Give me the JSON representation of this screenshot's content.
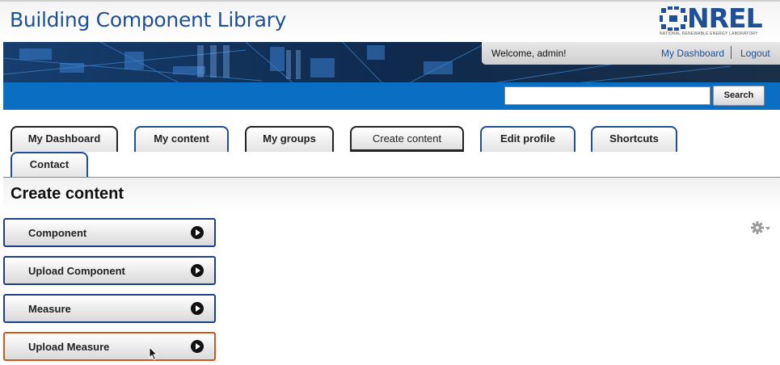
{
  "header": {
    "site_title": "Building Component Library",
    "logo_text": "NREL",
    "logo_subtitle": "NATIONAL RENEWABLE ENERGY LABORATORY"
  },
  "user_bar": {
    "welcome": "Welcome, admin!",
    "dashboard_link": "My Dashboard",
    "logout_link": "Logout"
  },
  "search": {
    "placeholder": "",
    "value": "",
    "button_label": "Search"
  },
  "tabs": [
    {
      "label": "My Dashboard"
    },
    {
      "label": "My content"
    },
    {
      "label": "My groups"
    },
    {
      "label": "Create content",
      "active": true
    },
    {
      "label": "Edit profile"
    },
    {
      "label": "Shortcuts"
    },
    {
      "label": "Contact"
    }
  ],
  "page": {
    "title": "Create content"
  },
  "content_types": [
    {
      "label": "Component"
    },
    {
      "label": "Upload Component"
    },
    {
      "label": "Measure"
    },
    {
      "label": "Upload Measure",
      "hovered": true
    }
  ],
  "icons": {
    "settings": "gear-icon",
    "item_arrow": "play-circle-icon",
    "pointer": "mouse-cursor-icon"
  },
  "colors": {
    "brand_blue": "#1f4f96",
    "search_bar": "#0a6fc2",
    "banner": "#102744",
    "hover_border": "#d0581e"
  }
}
